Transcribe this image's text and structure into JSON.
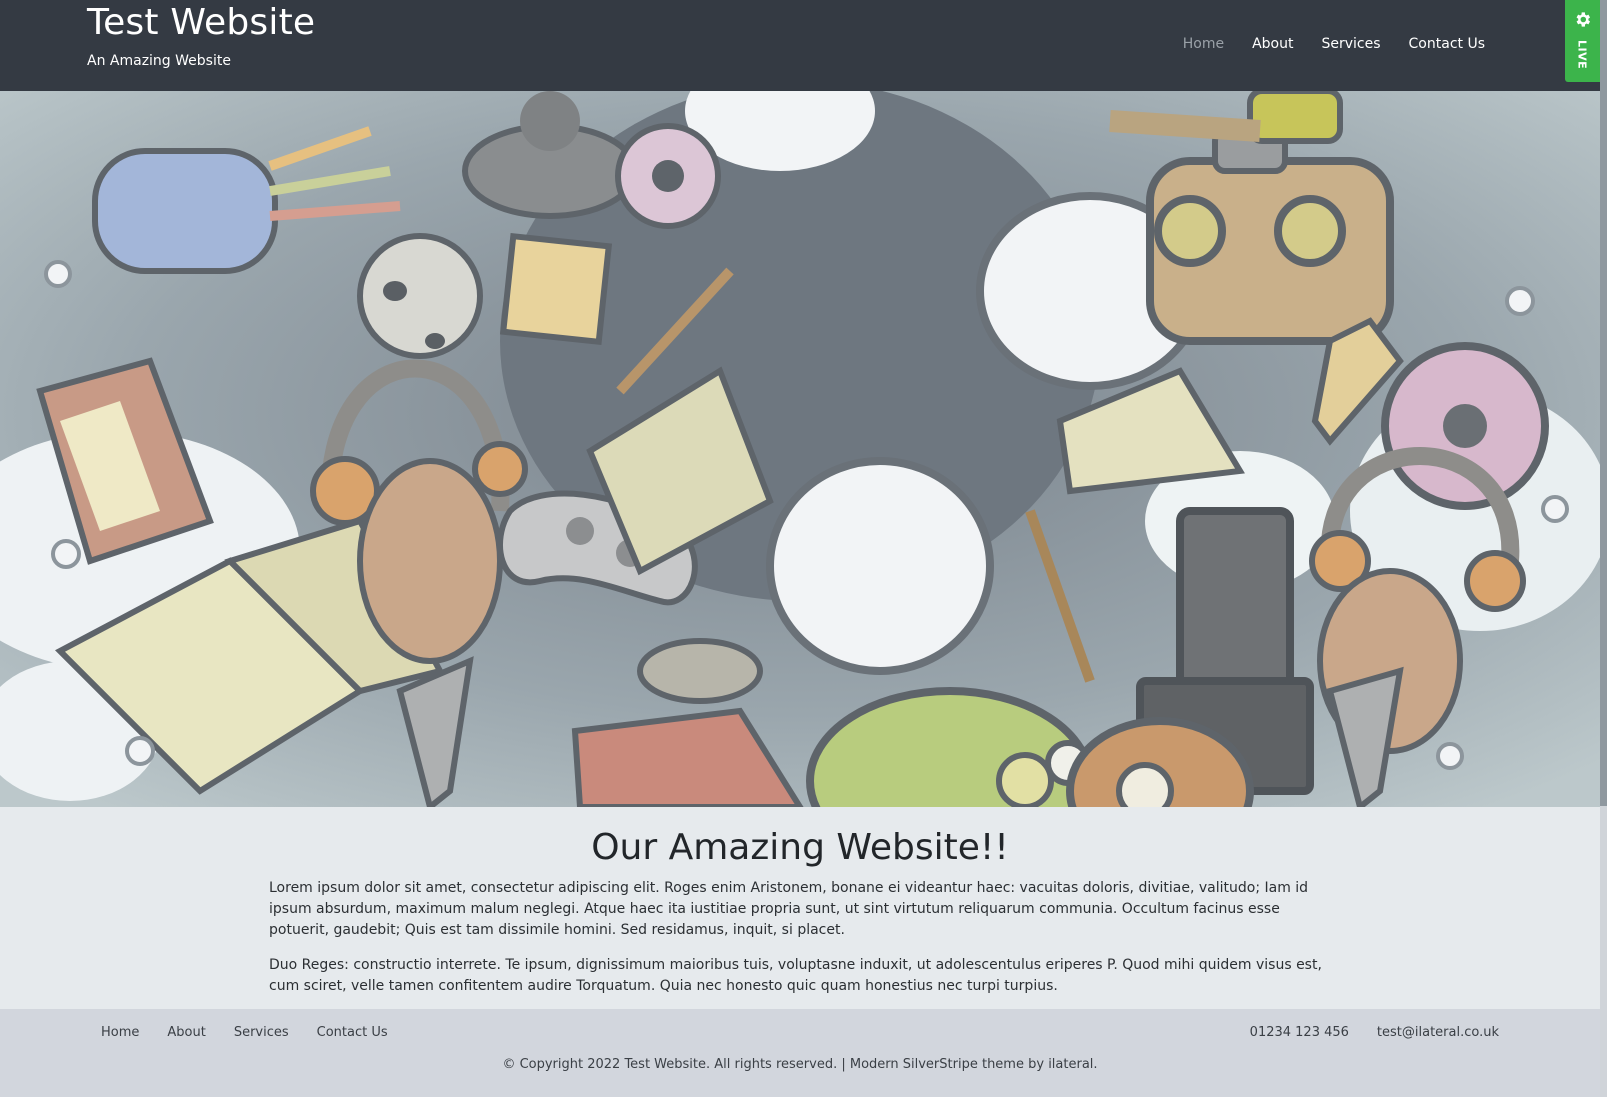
{
  "site": {
    "title": "Test Website",
    "tagline": "An Amazing Website"
  },
  "nav": {
    "items": [
      "Home",
      "About",
      "Services",
      "Contact Us"
    ],
    "active": "Home"
  },
  "live_badge": {
    "label": "LIVE",
    "icon": "gear-icon",
    "color": "#3cb44b"
  },
  "hero": {
    "image_description_icon": "doodle-illustration"
  },
  "content": {
    "heading": "Our Amazing Website!!",
    "paragraphs": [
      "Lorem ipsum dolor sit amet, consectetur adipiscing elit. Roges enim Aristonem, bonane ei videantur haec: vacuitas doloris, divitiae, valitudo; Iam id ipsum absurdum, maximum malum neglegi. Atque haec ita iustitiae propria sunt, ut sint virtutum reliquarum communia. Occultum facinus esse potuerit, gaudebit; Quis est tam dissimile homini. Sed residamus, inquit, si placet.",
      "Duo Reges: constructio interrete. Te ipsum, dignissimum maioribus tuis, voluptasne induxit, ut adolescentulus eriperes P. Quod mihi quidem visus est, cum sciret, velle tamen confitentem audire Torquatum. Quia nec honesto quic quam honestius nec turpi turpius."
    ]
  },
  "footer": {
    "nav": [
      "Home",
      "About",
      "Services",
      "Contact Us"
    ],
    "phone": "01234 123 456",
    "email": "test@ilateral.co.uk",
    "copyright": "© Copyright 2022 Test Website. All rights reserved. | ",
    "theme_link": "Modern SilverStripe theme",
    "by": " by ",
    "author_link": "ilateral",
    "end": "."
  },
  "colors": {
    "header_bg": "#343a43",
    "content_bg": "#e6eaed",
    "footer_bg": "#d2d6dd"
  }
}
